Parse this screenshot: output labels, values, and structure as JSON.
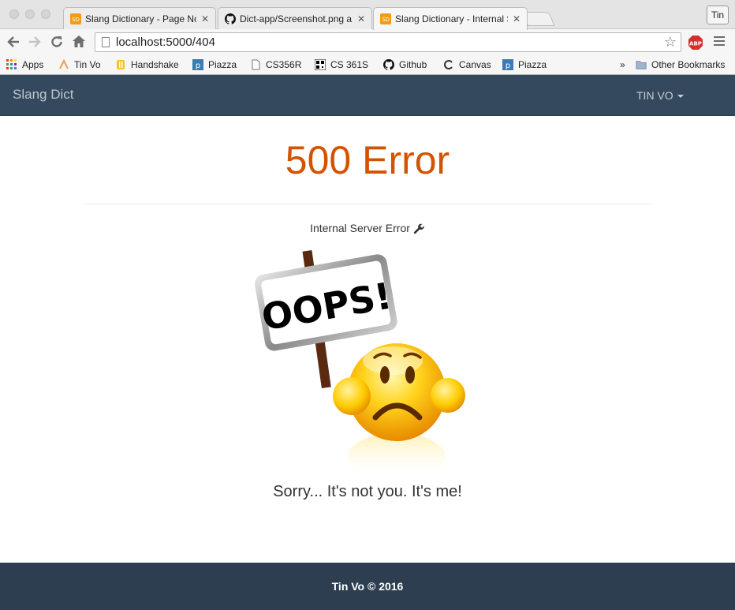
{
  "browser": {
    "tabs": [
      {
        "title": "Slang Dictionary - Page No",
        "icon": "slang-favicon"
      },
      {
        "title": "Dict-app/Screenshot.png a",
        "icon": "github-favicon"
      },
      {
        "title": "Slang Dictionary - Internal S",
        "icon": "slang-favicon"
      }
    ],
    "tab_close": "✕",
    "profile_label": "Tin",
    "url": "localhost:5000/404",
    "bookmarks": [
      {
        "label": "Apps",
        "icon": "apps-grid-icon"
      },
      {
        "label": "Tin Vo",
        "icon": "tin-vo-icon"
      },
      {
        "label": "Handshake",
        "icon": "handshake-icon"
      },
      {
        "label": "Piazza",
        "icon": "piazza-icon"
      },
      {
        "label": "CS356R",
        "icon": "document-icon"
      },
      {
        "label": "CS 361S",
        "icon": "qr-icon"
      },
      {
        "label": "Github",
        "icon": "github-icon"
      },
      {
        "label": "Canvas",
        "icon": "canvas-icon"
      },
      {
        "label": "Piazza",
        "icon": "piazza-icon"
      }
    ],
    "bookmarks_overflow": "»",
    "other_bookmarks": "Other Bookmarks"
  },
  "site": {
    "brand": "Slang Dict",
    "user_menu": "TIN VO",
    "error_title": "500 Error",
    "subtitle": "Internal Server Error",
    "sign_text": "OOPS!",
    "apology": "Sorry... It's not you. It's me!",
    "footer": "Tin Vo © 2016"
  },
  "colors": {
    "navbar": "#34495e",
    "footer": "#2c3e50",
    "error_title": "#d35400"
  }
}
